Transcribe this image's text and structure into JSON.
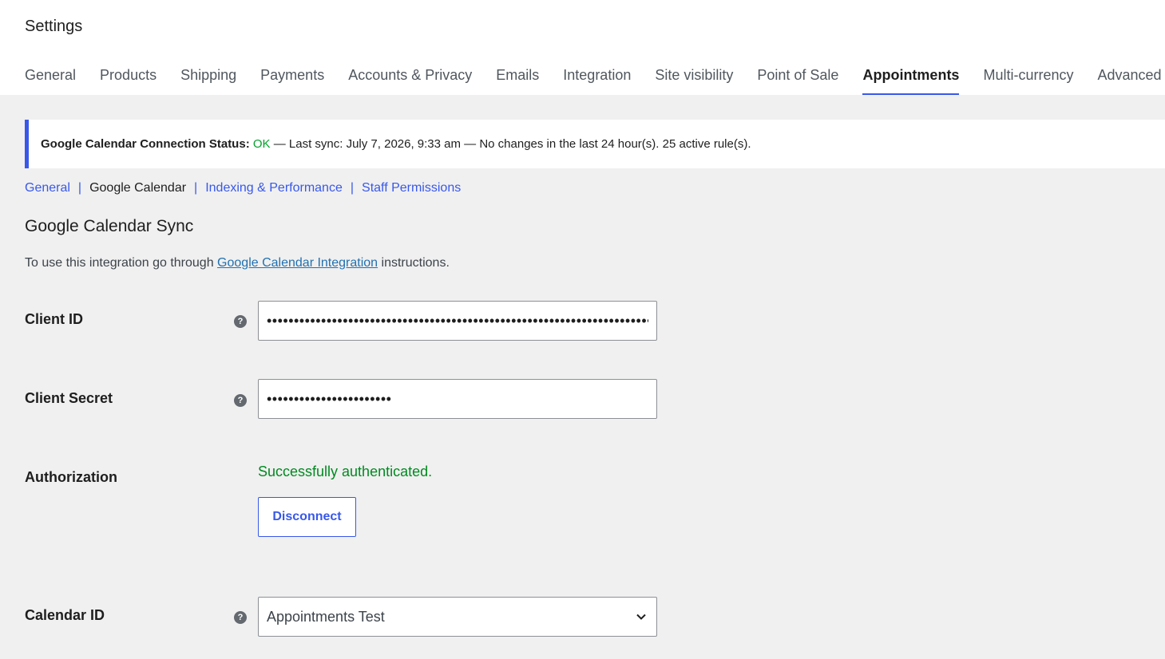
{
  "header": {
    "title": "Settings"
  },
  "tabs": [
    {
      "label": "General",
      "active": false
    },
    {
      "label": "Products",
      "active": false
    },
    {
      "label": "Shipping",
      "active": false
    },
    {
      "label": "Payments",
      "active": false
    },
    {
      "label": "Accounts & Privacy",
      "active": false
    },
    {
      "label": "Emails",
      "active": false
    },
    {
      "label": "Integration",
      "active": false
    },
    {
      "label": "Site visibility",
      "active": false
    },
    {
      "label": "Point of Sale",
      "active": false
    },
    {
      "label": "Appointments",
      "active": true
    },
    {
      "label": "Multi-currency",
      "active": false
    },
    {
      "label": "Advanced",
      "active": false
    }
  ],
  "notice": {
    "label": "Google Calendar Connection Status:",
    "status": "OK",
    "details": " — Last sync: July 7, 2026, 9:33 am — No changes in the last 24 hour(s). 25 active rule(s).",
    "accent_color": "#3858e9",
    "status_color": "#00a32a"
  },
  "subnav": {
    "items": [
      "General",
      "Google Calendar",
      "Indexing & Performance",
      "Staff Permissions"
    ],
    "separator": "|",
    "current": "Google Calendar"
  },
  "section": {
    "title": "Google Calendar Sync",
    "desc_prefix": "To use this integration go through ",
    "desc_link": "Google Calendar Integration",
    "desc_suffix": " instructions."
  },
  "fields": {
    "help_icon": "?",
    "client_id": {
      "label": "Client ID",
      "value": "•••••••••••••••••••••••••••••••••••••••••••••••••••••••••••••••••••••••"
    },
    "client_secret": {
      "label": "Client Secret",
      "value": "•••••••••••••••••••••••"
    },
    "authorization": {
      "label": "Authorization",
      "status": "Successfully authenticated.",
      "button": "Disconnect"
    },
    "calendar_id": {
      "label": "Calendar ID",
      "selected": "Appointments Test"
    }
  }
}
